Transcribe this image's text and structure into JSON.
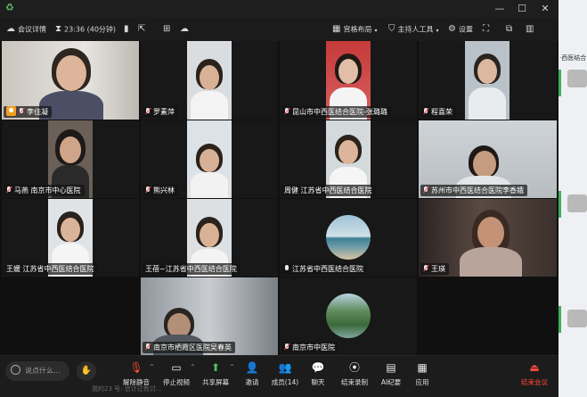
{
  "header": {
    "meeting_details": "会议详情",
    "timer": "23:36 (40分钟)",
    "layout": "宫格布局",
    "host_tools": "主持人工具",
    "settings": "设置"
  },
  "participants": [
    {
      "name": "李佳凝",
      "host": true,
      "muted": true
    },
    {
      "name": "罗素萍",
      "muted": true
    },
    {
      "name": "昆山市中西医结合医院-张璐璐",
      "muted": true
    },
    {
      "name": "程喜荣",
      "muted": true
    },
    {
      "name": "马燕 南京市中心医院",
      "muted": true
    },
    {
      "name": "熊兴林",
      "muted": true
    },
    {
      "name": "周健 江苏省中西医结合医院",
      "muted": false
    },
    {
      "name": "苏州市中西医结合医院李香娥",
      "muted": true
    },
    {
      "name": "王媛 江苏省中西医结合医院",
      "muted": false
    },
    {
      "name": "王蓓~江苏省中西医结合医院",
      "muted": false
    },
    {
      "name": "江苏省中西医结合医院",
      "muted": false,
      "mic_on": true
    },
    {
      "name": "王瑛",
      "muted": true
    },
    {
      "name": "南京市栖霞区医院吴春英",
      "muted": true
    },
    {
      "name": "南京市中医院",
      "muted": true
    }
  ],
  "toolbar": {
    "chat_placeholder": "说点什么...",
    "unmute": "解除静音",
    "stop_video": "停止视频",
    "share_screen": "共享屏幕",
    "invite": "邀请",
    "members": "成员(14)",
    "chat": "聊天",
    "end_record": "结束录制",
    "ai_minutes": "AI纪要",
    "apps": "应用",
    "end_meeting": "结束会议"
  },
  "taskbar_text": "我的23 号: 信计过有讨...",
  "right_panel": {
    "label1": "·西医结合"
  },
  "colors": {
    "accent_red": "#ff4a36",
    "host_orange": "#f0a020",
    "brand_green": "#3fae5a"
  }
}
